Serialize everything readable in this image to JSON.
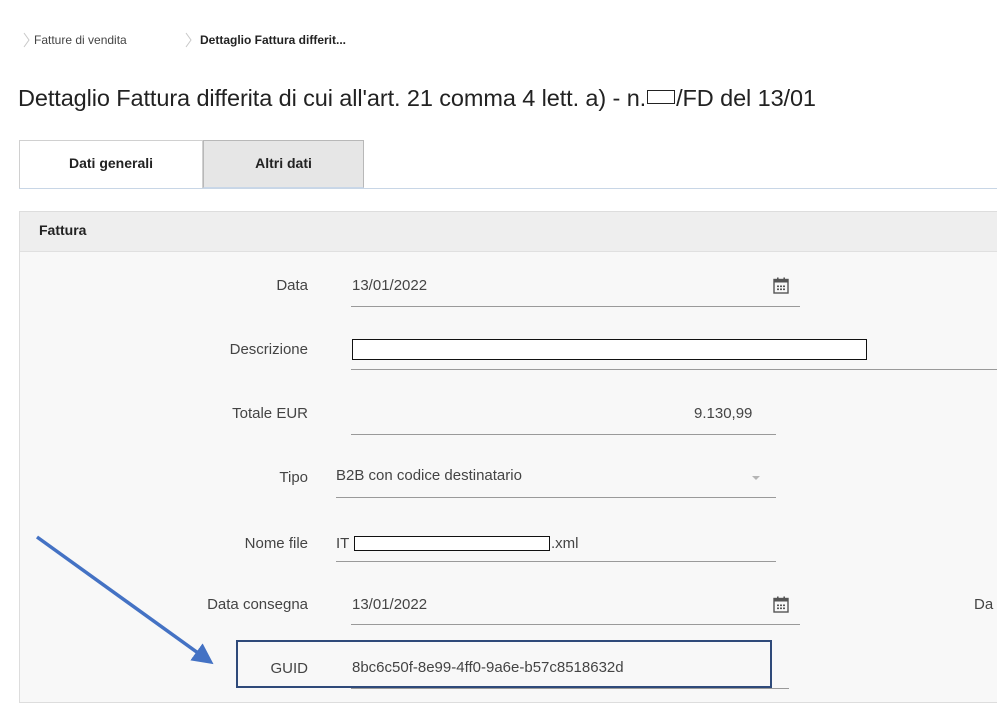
{
  "breadcrumb": {
    "items": [
      "Fatture di vendita",
      "Dettaglio Fattura differit..."
    ]
  },
  "page": {
    "title_prefix": "Dettaglio Fattura differita di cui all'art. 21 comma 4 lett. a) - n.",
    "title_suffix": "/FD del 13/01"
  },
  "tabs": [
    {
      "label": "Dati generali",
      "active": true
    },
    {
      "label": "Altri dati",
      "active": false
    }
  ],
  "section": {
    "title": "Fattura"
  },
  "fields": {
    "data": {
      "label": "Data",
      "value": "13/01/2022"
    },
    "descrizione": {
      "label": "Descrizione",
      "value": ""
    },
    "totale": {
      "label": "Totale EUR",
      "value": "9.130,99"
    },
    "tipo": {
      "label": "Tipo",
      "value": "B2B con codice destinatario"
    },
    "nome_file": {
      "label": "Nome file",
      "value_prefix": "IT",
      "value_suffix": ".xml"
    },
    "data_consegna": {
      "label": "Data consegna",
      "value": "13/01/2022",
      "right_label_partial": "Da"
    },
    "guid": {
      "label": "GUID",
      "value": "8bc6c50f-8e99-4ff0-9a6e-b57c8518632d"
    }
  },
  "colors": {
    "arrow": "#4472c4",
    "highlight_box": "#2f4a7a",
    "tab_inactive_bg": "#e6e6e6"
  },
  "icons": {
    "date_picker": "calendar-icon",
    "select": "chevron-down-icon",
    "breadcrumb_sep": "chevron-right-icon"
  }
}
